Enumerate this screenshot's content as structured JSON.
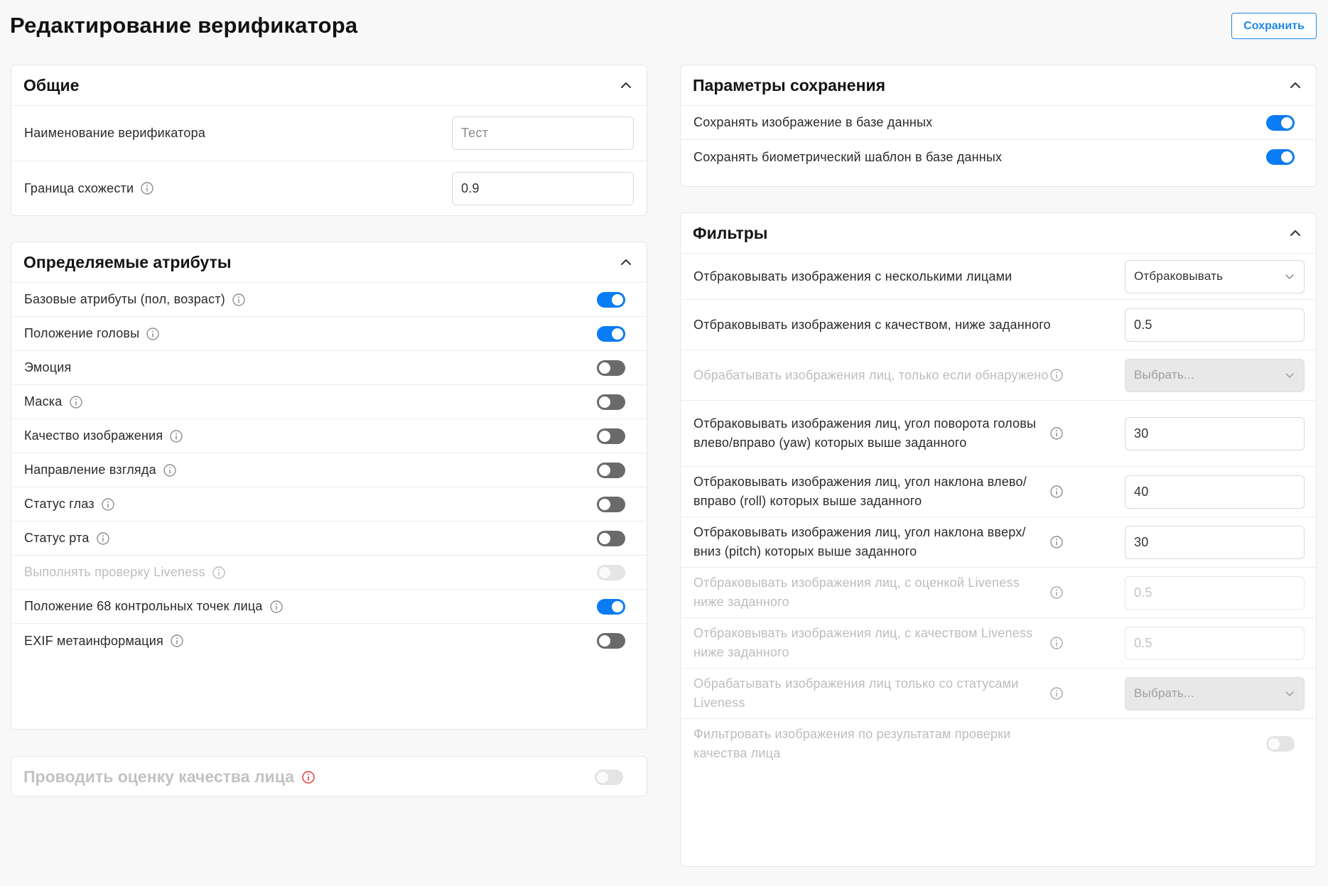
{
  "page": {
    "title": "Редактирование верификатора",
    "save_label": "Сохранить"
  },
  "general": {
    "title": "Общие",
    "name_label": "Наименование верификатора",
    "name_value": "Тест",
    "threshold_label": "Граница схожести",
    "threshold_value": "0.9"
  },
  "attributes": {
    "title": "Определяемые атрибуты",
    "items": [
      {
        "label": "Базовые атрибуты (пол, возраст)",
        "info": true,
        "state": "on"
      },
      {
        "label": "Положение головы",
        "info": true,
        "state": "on"
      },
      {
        "label": "Эмоция",
        "info": false,
        "state": "off"
      },
      {
        "label": "Маска",
        "info": true,
        "state": "off"
      },
      {
        "label": "Качество изображения",
        "info": true,
        "state": "off"
      },
      {
        "label": "Направление взгляда",
        "info": true,
        "state": "off"
      },
      {
        "label": "Статус глаз",
        "info": true,
        "state": "off"
      },
      {
        "label": "Статус рта",
        "info": true,
        "state": "off"
      },
      {
        "label": "Выполнять проверку Liveness",
        "info": true,
        "state": "disabled"
      },
      {
        "label": "Положение 68 контрольных точек лица",
        "info": true,
        "state": "on"
      },
      {
        "label": "EXIF метаинформация",
        "info": true,
        "state": "off"
      }
    ]
  },
  "quality": {
    "title": "Проводить оценку качества лица",
    "state": "disabled"
  },
  "storage": {
    "title": "Параметры сохранения",
    "items": [
      {
        "label": "Сохранять изображение в базе данных",
        "state": "on"
      },
      {
        "label": "Сохранять биометрический шаблон в базе данных",
        "state": "on"
      }
    ]
  },
  "filters": {
    "title": "Фильтры",
    "items": [
      {
        "label": "Отбраковывать изображения с несколькими лицами",
        "info": false,
        "disabled": false,
        "control": "select",
        "value": "Отбраковывать"
      },
      {
        "label": "Отбраковывать изображения с качеством, ниже заданного",
        "info": false,
        "disabled": false,
        "control": "input",
        "value": "0.5"
      },
      {
        "label": "Обрабатывать изображения лиц, только если обнаружено",
        "info": true,
        "disabled": true,
        "control": "select",
        "value": "Выбрать..."
      },
      {
        "label": "Отбраковывать изображения лиц, угол поворота головы влево/вправо (yaw) которых выше заданного",
        "info": true,
        "disabled": false,
        "control": "input",
        "value": "30"
      },
      {
        "label": "Отбраковывать изображения лиц, угол наклона влево/вправо (roll) которых выше заданного",
        "info": true,
        "disabled": false,
        "control": "input",
        "value": "40"
      },
      {
        "label": "Отбраковывать изображения лиц, угол наклона вверх/вниз (pitch) которых выше заданного",
        "info": true,
        "disabled": false,
        "control": "input",
        "value": "30"
      },
      {
        "label": "Отбраковывать изображения лиц, с оценкой Liveness ниже заданного",
        "info": true,
        "disabled": true,
        "control": "input",
        "value": "0.5"
      },
      {
        "label": "Отбраковывать изображения лиц, с качеством Liveness ниже заданного",
        "info": true,
        "disabled": true,
        "control": "input",
        "value": "0.5"
      },
      {
        "label": "Обрабатывать изображения лиц только со статусами Liveness",
        "info": true,
        "disabled": true,
        "control": "select",
        "value": "Выбрать..."
      },
      {
        "label": "Фильтровать изображения по результатам проверки качества лица",
        "info": false,
        "disabled": true,
        "control": "toggle",
        "value": "disabled"
      }
    ]
  },
  "icons": {
    "collapse": "chevron-up-icon",
    "info": "info-icon",
    "dropdown": "chevron-down-icon"
  },
  "colors": {
    "accent": "#0a7cf5",
    "toggle_off": "#6a6a6a",
    "toggle_disabled": "#e4e4e4",
    "warning_info": "#e53935"
  }
}
